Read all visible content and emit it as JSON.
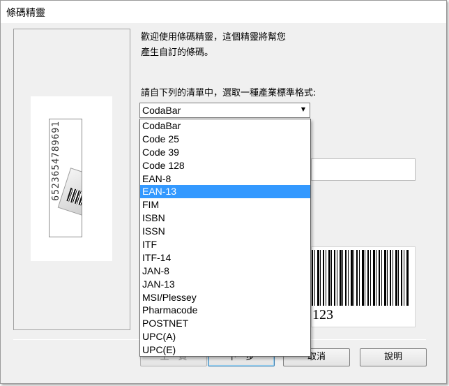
{
  "window": {
    "title": "條碼精靈"
  },
  "preview": {
    "strip_digits": "6523654789691",
    "barcode_text": "123"
  },
  "intro": {
    "line1": "歡迎使用條碼精靈，這個精靈將幫您",
    "line2": "產生自訂的條碼。"
  },
  "format": {
    "prompt": "請自下列的清單中，選取一種產業標準格式:",
    "selected_value": "CodaBar",
    "options": [
      "CodaBar",
      "Code 25",
      "Code 39",
      "Code 128",
      "EAN-8",
      "EAN-13",
      "FIM",
      "ISBN",
      "ISSN",
      "ITF",
      "ITF-14",
      "JAN-8",
      "JAN-13",
      "MSI/Plessey",
      "Pharmacode",
      "POSTNET",
      "UPC(A)",
      "UPC(E)"
    ],
    "highlighted_option": "EAN-13"
  },
  "buttons": {
    "back": "上一頁",
    "next": "下一步",
    "cancel": "取消",
    "help": "說明"
  },
  "icons": {
    "combo_arrow": "dropdown-arrow-icon"
  },
  "colors": {
    "highlight": "#3399ff",
    "default_button_border": "#3c7fb1"
  }
}
